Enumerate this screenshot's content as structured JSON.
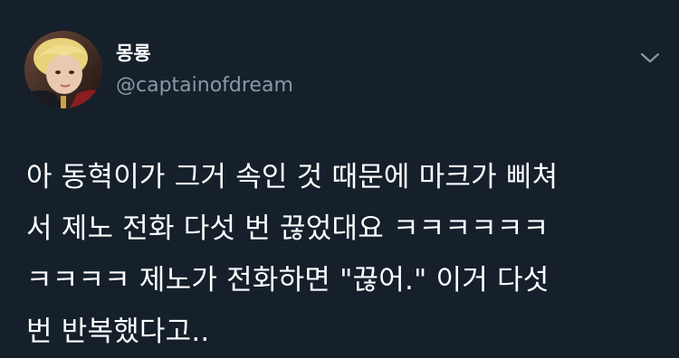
{
  "tweet": {
    "author": {
      "display_name": "몽룡",
      "handle": "@captainofdream"
    },
    "text_lines": [
      "아 동혁이가 그거 속인 것 때문에 마크가 삐쳐",
      "서 제노 전화 다섯 번 끊었대요 ㅋㅋㅋㅋㅋㅋ",
      "ㅋㅋㅋㅋ 제노가 전화하면 \"끊어.\" 이거 다섯",
      "번 반복했다고.."
    ],
    "menu_icon": "chevron-down-icon"
  },
  "colors": {
    "background": "#15202b",
    "text": "#ffffff",
    "secondary_text": "#8899a6"
  }
}
